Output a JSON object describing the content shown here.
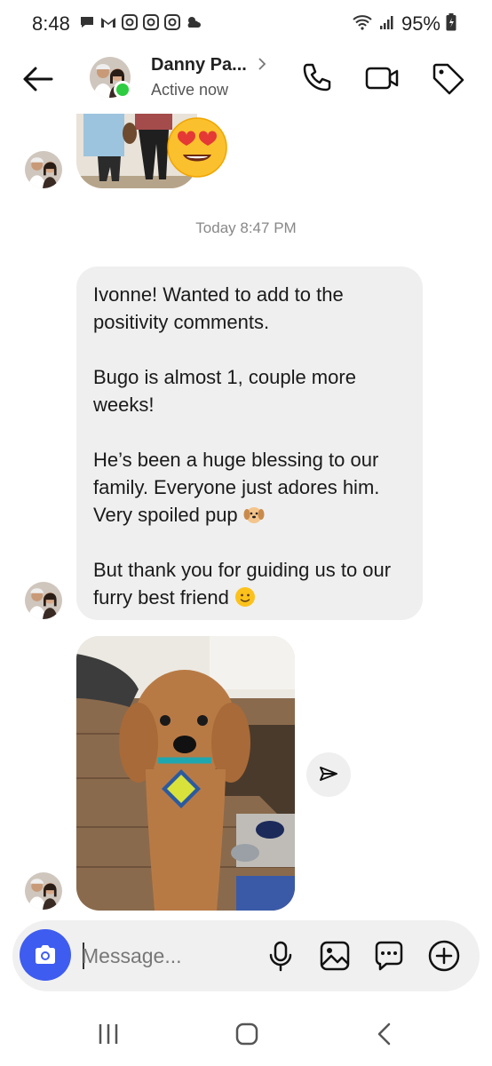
{
  "status_bar": {
    "time": "8:48",
    "battery": "95%",
    "notification_icons": [
      "chat-bubble-icon",
      "gmail-icon",
      "instagram-icon",
      "instagram-icon",
      "instagram-icon",
      "weather-icon"
    ],
    "right_icons": [
      "wifi-icon",
      "signal-icon",
      "battery-icon"
    ]
  },
  "header": {
    "contact_name": "Danny Pa...",
    "contact_status": "Active now",
    "online_color": "#2ecc40"
  },
  "chat": {
    "reaction": "heart-eyes-emoji",
    "timestamp": "Today 8:47 PM",
    "message_paragraphs": [
      "Ivonne! Wanted to add to the positivity comments.",
      "Bugo is almost 1, couple more weeks!",
      "He’s been a huge blessing to our family. Everyone just adores him. Very spoiled pup",
      "But thank you for guiding us to our furry best friend"
    ],
    "message_emojis": [
      "dog-face-emoji",
      "slight-smile-emoji"
    ],
    "bubble_color": "#efefef"
  },
  "composer": {
    "placeholder": "Message...",
    "value": "",
    "accent": "#3e5cf0"
  }
}
